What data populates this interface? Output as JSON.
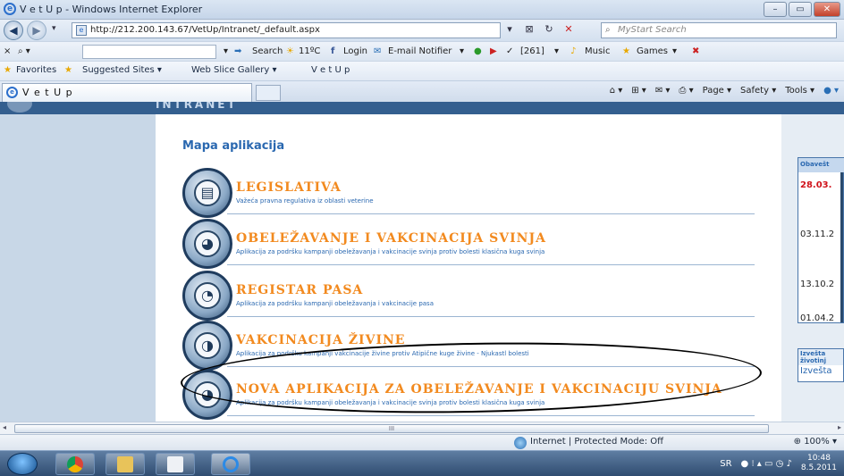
{
  "window": {
    "title": "V e t U p - Windows Internet Explorer",
    "controls": [
      "–",
      "▭",
      "✕"
    ]
  },
  "address": {
    "url": "http://212.200.143.67/VetUp/Intranet/_default.aspx",
    "search_placeholder": "MyStart Search"
  },
  "toolbar": {
    "search": "Search",
    "weather": "11ºC",
    "login": "Login",
    "email": "E-mail Notifier",
    "count": "[261]",
    "music": "Music",
    "games": "Games"
  },
  "favorites": {
    "label": "Favorites",
    "items": [
      "Suggested Sites ▾",
      "Web Slice Gallery ▾",
      "V e t U p"
    ]
  },
  "tab": {
    "label": "V e t U p"
  },
  "command_bar": [
    "Page ▾",
    "Safety ▾",
    "Tools ▾"
  ],
  "page": {
    "banner_text": "INTRANET",
    "map_title": "Mapa aplikacija",
    "apps": [
      {
        "name": "LEGISLATIVA",
        "desc": "Važeća pravna regulativa iz oblasti veterine",
        "icon": "document-icon"
      },
      {
        "name": "OBELEŽAVANJE I VAKCINACIJA SVINJA",
        "desc": "Aplikacija za podršku kampanji obeležavanja i vakcinacije svinja protiv bolesti klasična kuga svinja",
        "icon": "pig-icon"
      },
      {
        "name": "REGISTAR PASA",
        "desc": "Aplikacija za podršku kampanji obeležavanja i vakcinacije pasa",
        "icon": "dog-icon"
      },
      {
        "name": "VAKCINACIJA ŽIVINE",
        "desc": "Aplikacija za podršku kampanji vakcinacije živine protiv Atipične kuge živine - Njukastl bolesti",
        "icon": "bird-icon"
      },
      {
        "name": "NOVA APLIKACIJA ZA OBELEŽAVANJE I VAKCINACIJU SVINJA",
        "desc": "Aplikacija za podršku kampanji obeležavanja i vakcinacije svinja protiv bolesti klasična kuga svinja",
        "icon": "pig-icon"
      }
    ],
    "notices": {
      "header": "Obavešt",
      "dates": [
        "28.03.",
        "03.11.2",
        "13.10.2",
        "01.04.2"
      ]
    },
    "reports": {
      "header": "Izvešta životinj",
      "link": "Izvešta"
    }
  },
  "status": {
    "zone": "Internet | Protected Mode: Off",
    "zoom": "100%",
    "scroll_label": "III"
  },
  "taskbar": {
    "lang": "SR",
    "time": "10:48",
    "date": "8.5.2011"
  }
}
